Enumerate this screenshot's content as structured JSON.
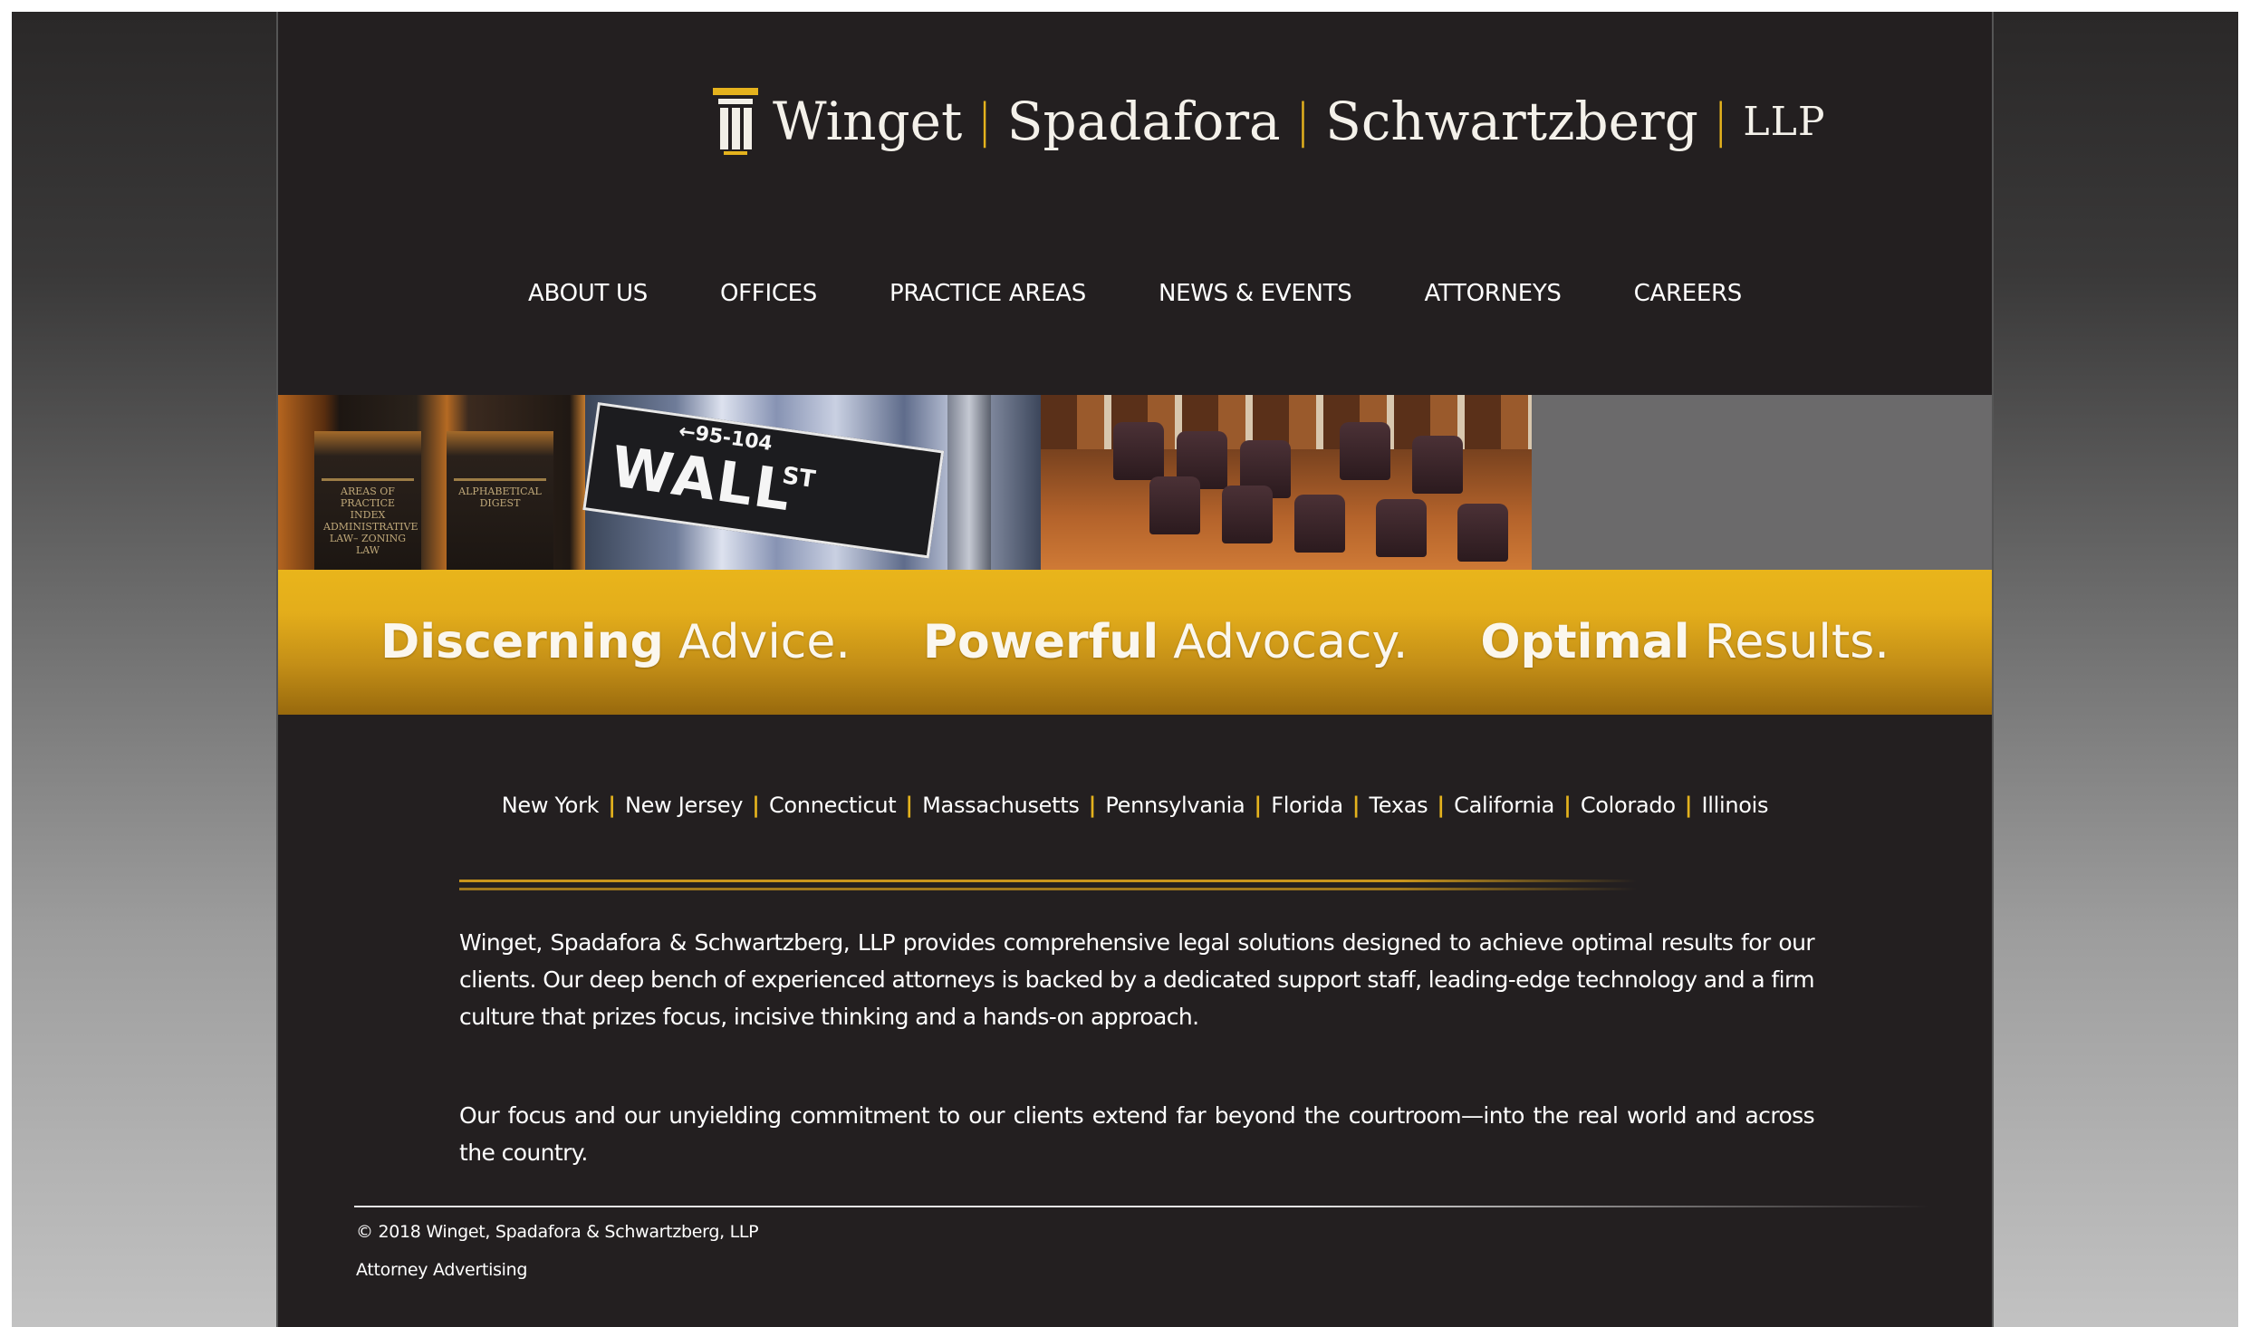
{
  "logo": {
    "parts": [
      "Winget",
      "Spadafora",
      "Schwartzberg",
      "LLP"
    ],
    "separator": "|",
    "icon": "column-logo-icon"
  },
  "nav": {
    "items": [
      {
        "label": "ABOUT US"
      },
      {
        "label": "OFFICES"
      },
      {
        "label": "PRACTICE AREAS"
      },
      {
        "label": "NEWS & EVENTS"
      },
      {
        "label": "ATTORNEYS"
      },
      {
        "label": "CAREERS"
      }
    ]
  },
  "banner": {
    "book_labels": [
      "AREAS OF PRACTICE INDEX ADMINISTRATIVE LAW– ZONING LAW",
      "ALPHABETICAL DIGEST"
    ],
    "sign": {
      "street": "WALL",
      "suffix": "ST",
      "numbers": "←95-104"
    }
  },
  "tagline": [
    {
      "bold": "Discerning",
      "rest": "Advice."
    },
    {
      "bold": "Powerful",
      "rest": "Advocacy."
    },
    {
      "bold": "Optimal",
      "rest": "Results."
    }
  ],
  "states": {
    "separator": "|",
    "items": [
      "New York",
      "New Jersey",
      "Connecticut",
      "Massachusetts",
      "Pennsylvania",
      "Florida",
      "Texas",
      "California",
      "Colorado",
      "Illinois"
    ]
  },
  "body": {
    "paragraph1": "Winget, Spadafora & Schwartzberg, LLP provides comprehensive legal solutions designed to achieve optimal results for our clients. Our deep bench of experienced attorneys is backed by a dedicated support staff, leading-edge technology and a firm culture that prizes focus, incisive thinking and a hands-on approach.",
    "paragraph2": "Our focus and our unyielding commitment to our clients extend far beyond the courtroom—into the real world and across the country."
  },
  "footer": {
    "copyright": "© 2018 Winget, Spadafora & Schwartzberg, LLP",
    "advertising": "Attorney Advertising"
  },
  "colors": {
    "accent_gold": "#e4b21d",
    "page_background": "#231f20",
    "text": "#ffffff"
  }
}
